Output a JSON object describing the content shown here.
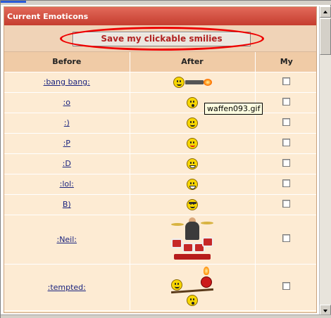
{
  "panel": {
    "title": "Current Emoticons",
    "save_label": "Save my clickable smilies"
  },
  "table": {
    "headers": [
      "Before",
      "After",
      "My"
    ],
    "rows": [
      {
        "code": ":bang bang:",
        "icon": "gun-shooting-smiley-icon"
      },
      {
        "code": ":o",
        "icon": "surprised-smiley-icon"
      },
      {
        "code": ":)",
        "icon": "smile-smiley-icon"
      },
      {
        "code": ":P",
        "icon": "tongue-smiley-icon"
      },
      {
        "code": ":D",
        "icon": "big-grin-smiley-icon"
      },
      {
        "code": ":lol:",
        "icon": "laughing-smiley-icon"
      },
      {
        "code": "B)",
        "icon": "sunglasses-smiley-icon"
      },
      {
        "code": ":Neil:",
        "icon": "drummer-image-icon"
      },
      {
        "code": ":tempted:",
        "icon": "seesaw-devil-smiley-icon"
      }
    ]
  },
  "tooltip": {
    "text": "waffen093.gif"
  },
  "colors": {
    "header": "#c53d2f",
    "row_bg": "#fdebd3",
    "button_text": "#b22222",
    "highlight_ellipse": "#ee0000"
  }
}
